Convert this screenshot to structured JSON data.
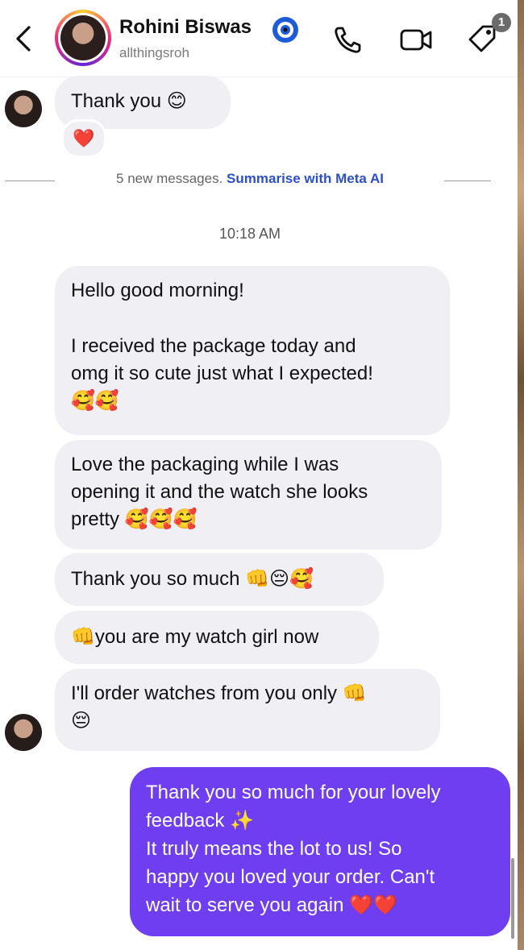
{
  "header": {
    "back_icon": "chevron-left-icon",
    "name": "Rohini Biswas",
    "handle": "allthingsroh",
    "verified_icon": "verified-badge-icon",
    "call_icon": "phone-icon",
    "video_icon": "video-camera-icon",
    "tag_icon": "tag-icon",
    "tag_badge_count": "1"
  },
  "earlier": {
    "message": "Thank you 😊",
    "reaction": "❤️"
  },
  "divider": {
    "text": "5 new messages.",
    "link": "Summarise with Meta AI"
  },
  "timestamp": "10:18 AM",
  "incoming": [
    {
      "lines": [
        "Hello good morning!",
        "",
        "I received the package today and",
        "omg it so cute just what I expected!",
        "🥰🥰"
      ]
    },
    {
      "lines": [
        "Love the packaging while I was",
        "opening it and the watch she looks",
        "pretty 🥰🥰🥰"
      ]
    },
    {
      "lines": [
        "Thank you so much 👊😔🥰"
      ]
    },
    {
      "lines": [
        "👊you are my watch girl now"
      ]
    },
    {
      "lines": [
        "I'll order watches from you only 👊",
        "😔"
      ]
    }
  ],
  "outgoing": {
    "lines": [
      "Thank you so much for your lovely",
      "feedback ✨",
      "It truly means the lot to us! So",
      "happy you loved your order. Can't",
      "wait to serve you again ❤️❤️"
    ]
  },
  "colors": {
    "outgoing_bubble": "#6e3ef0",
    "incoming_bubble": "#efeff4",
    "meta_link": "#2b50c8"
  }
}
